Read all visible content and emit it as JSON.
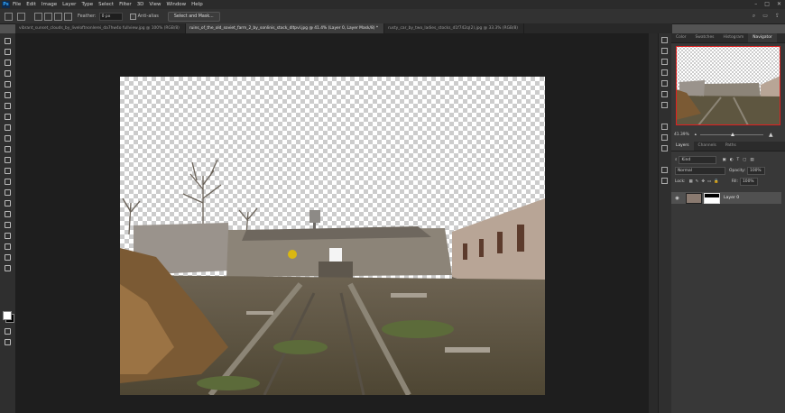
{
  "app": {
    "logo": "Ps"
  },
  "menu": [
    "File",
    "Edit",
    "Image",
    "Layer",
    "Type",
    "Select",
    "Filter",
    "3D",
    "View",
    "Window",
    "Help"
  ],
  "window_controls": [
    "–",
    "□",
    "✕"
  ],
  "options_bar": {
    "feather_label": "Feather:",
    "feather_value": "0 px",
    "antialias_label": "Anti-alias",
    "select_and_mask": "Select and Mask..."
  },
  "tabs": [
    {
      "label": "vibrant_sunset_clouds_by_liveloftnonlerei_da7hw4o fullview.jpg @ 100% (RGB/8)",
      "active": false
    },
    {
      "label": "ruins_of_the_old_soviet_farm_2_by_sonlinis_stock_dltpvl.jpg @ 41.4% (Layer 0, Layer Mask/8) *",
      "active": true
    },
    {
      "label": "rusty_car_by_two_ladies_stocks_d1f742q(2).jpg @ 33.3% (RGB/8)",
      "active": false
    }
  ],
  "right_panel": {
    "top_tabs": [
      "Color",
      "Swatches",
      "Histogram",
      "Navigator"
    ],
    "active_top_tab": "Navigator",
    "zoom_value": "41.39%",
    "layer_tabs": [
      "Layers",
      "Channels",
      "Paths"
    ],
    "kind_label": "Kind",
    "blend_mode": "Normal",
    "opacity_label": "Opacity:",
    "opacity_value": "100%",
    "lock_label": "Lock:",
    "fill_label": "Fill:",
    "fill_value": "100%",
    "layers": [
      {
        "name": "Layer 0",
        "visible": true
      }
    ]
  },
  "colors": {
    "menubar": "#2b2b2b",
    "workspace": "#1e1e1e",
    "panel": "#383838",
    "accent_navigator_box": "#e02020"
  },
  "icons": [
    "move-icon",
    "marquee-icon",
    "lasso-icon",
    "quick-select-icon",
    "crop-icon",
    "frame-icon",
    "eyedropper-icon",
    "healing-icon",
    "brush-icon",
    "stamp-icon",
    "history-brush-icon",
    "eraser-icon",
    "gradient-icon",
    "blur-icon",
    "dodge-icon",
    "pen-icon",
    "type-icon",
    "path-select-icon",
    "shape-icon",
    "hand-icon",
    "zoom-icon",
    "more-icon",
    "eye-icon",
    "search-icon",
    "gear-icon"
  ]
}
